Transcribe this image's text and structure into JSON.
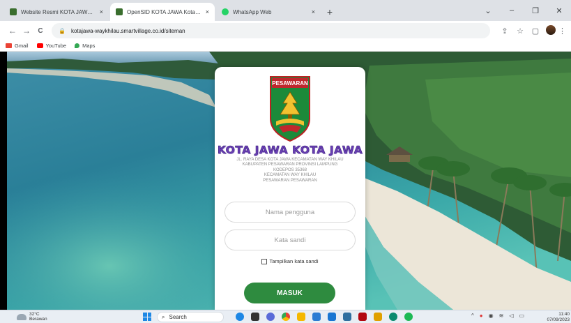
{
  "browser": {
    "tabs": [
      {
        "label": "Website Resmi KOTA JAWA Kota ·",
        "favicon_color": "#3a6e2e",
        "active": false
      },
      {
        "label": "OpenSID KOTA JAWA Kota Jawa",
        "favicon_color": "#3a6e2e",
        "active": true
      },
      {
        "label": "WhatsApp Web",
        "favicon_color": "#25d366",
        "active": false
      }
    ],
    "close_glyph": "×",
    "new_tab_glyph": "+",
    "window_controls": [
      "⌄",
      "–",
      "❐",
      "✕"
    ],
    "nav": {
      "back": "←",
      "forward": "→",
      "reload": "C"
    },
    "url": "kotajawa-waykhilau.smartvillage.co.id/siteman",
    "lock_icon": "lock-icon",
    "toolbar_icons": [
      "share-icon",
      "star-icon",
      "sidepanel-icon",
      "profile-avatar"
    ],
    "bookmarks": [
      {
        "label": "Gmail",
        "color": "#ea4335"
      },
      {
        "label": "YouTube",
        "color": "#ff0000"
      },
      {
        "label": "Maps",
        "color": "#34a853"
      }
    ]
  },
  "login": {
    "logo_text": "PESAWARAN",
    "village_title": "KOTA JAWA KOTA JAWA",
    "address_lines": [
      "JL. RAYA DESA KOTA JAWA KECAMATAN WAY KHILAU",
      "KABUPATEN PESAWARAN PROVINSI LAMPUNG",
      "KODEPOS 35368",
      "KECAMATAN WAY KHILAU",
      "PESAWARAN PESAWARAN"
    ],
    "username_placeholder": "Nama pengguna",
    "password_placeholder": "Kata sandi",
    "show_password_label": "Tampilkan kata sandi",
    "submit_label": "MASUK",
    "accent_color": "#2e8b3f"
  },
  "taskbar": {
    "weather_temp": "32°C",
    "weather_desc": "Berawan",
    "search_label": "Search",
    "pinned_apps": [
      {
        "name": "edge-app",
        "color": "#1e88e5"
      },
      {
        "name": "files-app",
        "color": "#333"
      },
      {
        "name": "chat-app",
        "color": "#5a6bd8"
      },
      {
        "name": "chrome-app",
        "color": "#e94235"
      },
      {
        "name": "explorer-app",
        "color": "#f5b800"
      },
      {
        "name": "mail-app",
        "color": "#2b7cd3"
      },
      {
        "name": "store-app",
        "color": "#1976d2"
      },
      {
        "name": "calculator-app",
        "color": "#2f6f9f"
      },
      {
        "name": "netflix-app",
        "color": "#b20710"
      },
      {
        "name": "photos-app",
        "color": "#e0a000"
      },
      {
        "name": "settings-app",
        "color": "#0b8a6e"
      },
      {
        "name": "spotify-app",
        "color": "#1db954"
      }
    ],
    "time": "11:40",
    "date": "07/09/2023"
  }
}
